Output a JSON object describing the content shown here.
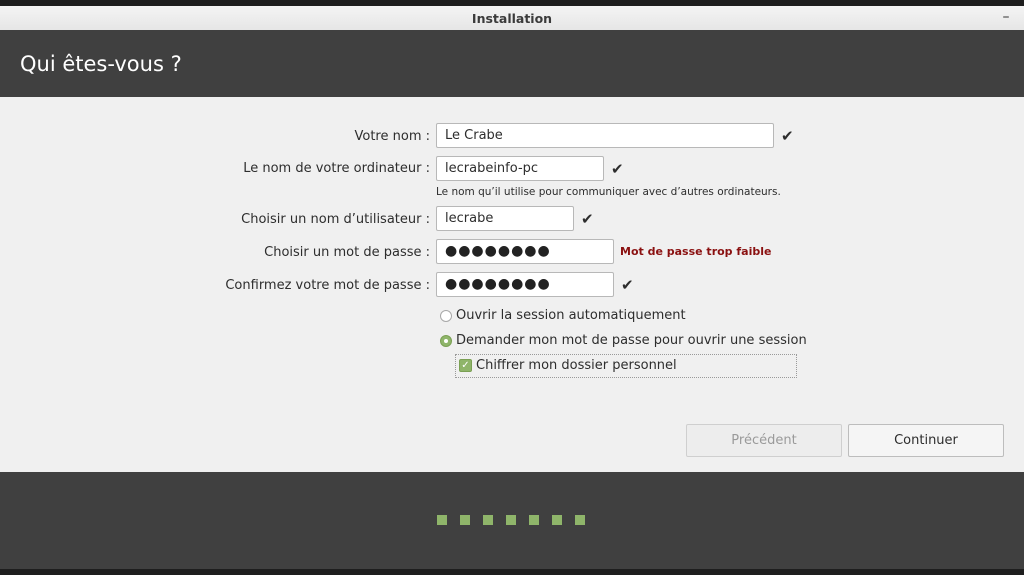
{
  "window": {
    "title": "Installation",
    "minimize_glyph": "–"
  },
  "header": {
    "title": "Qui êtes-vous ?"
  },
  "form": {
    "name_label": "Votre nom :",
    "name_value": "Le Crabe",
    "computer_label": "Le nom de votre ordinateur :",
    "computer_value": "lecrabeinfo-pc",
    "computer_hint": "Le nom qu’il utilise pour communiquer avec d’autres ordinateurs.",
    "username_label": "Choisir un nom d’utilisateur :",
    "username_value": "lecrabe",
    "password_label": "Choisir un mot de passe :",
    "password_value": "●●●●●●●●",
    "password_warning": "Mot de passe trop faible",
    "confirm_label": "Confirmez votre mot de passe :",
    "confirm_value": "●●●●●●●●",
    "check_glyph": "✔"
  },
  "options": {
    "auto_login_label": "Ouvrir la session automatiquement",
    "ask_password_label": "Demander mon mot de passe pour ouvrir une session",
    "encrypt_label": "Chiffrer mon dossier personnel",
    "encrypt_checked": true,
    "selected": "ask_password"
  },
  "buttons": {
    "back": "Précédent",
    "continue": "Continuer"
  },
  "progress": {
    "total_steps": 7
  },
  "colors": {
    "accent": "#8fb56a",
    "header_bg": "#404040",
    "warning": "#8a1010"
  }
}
